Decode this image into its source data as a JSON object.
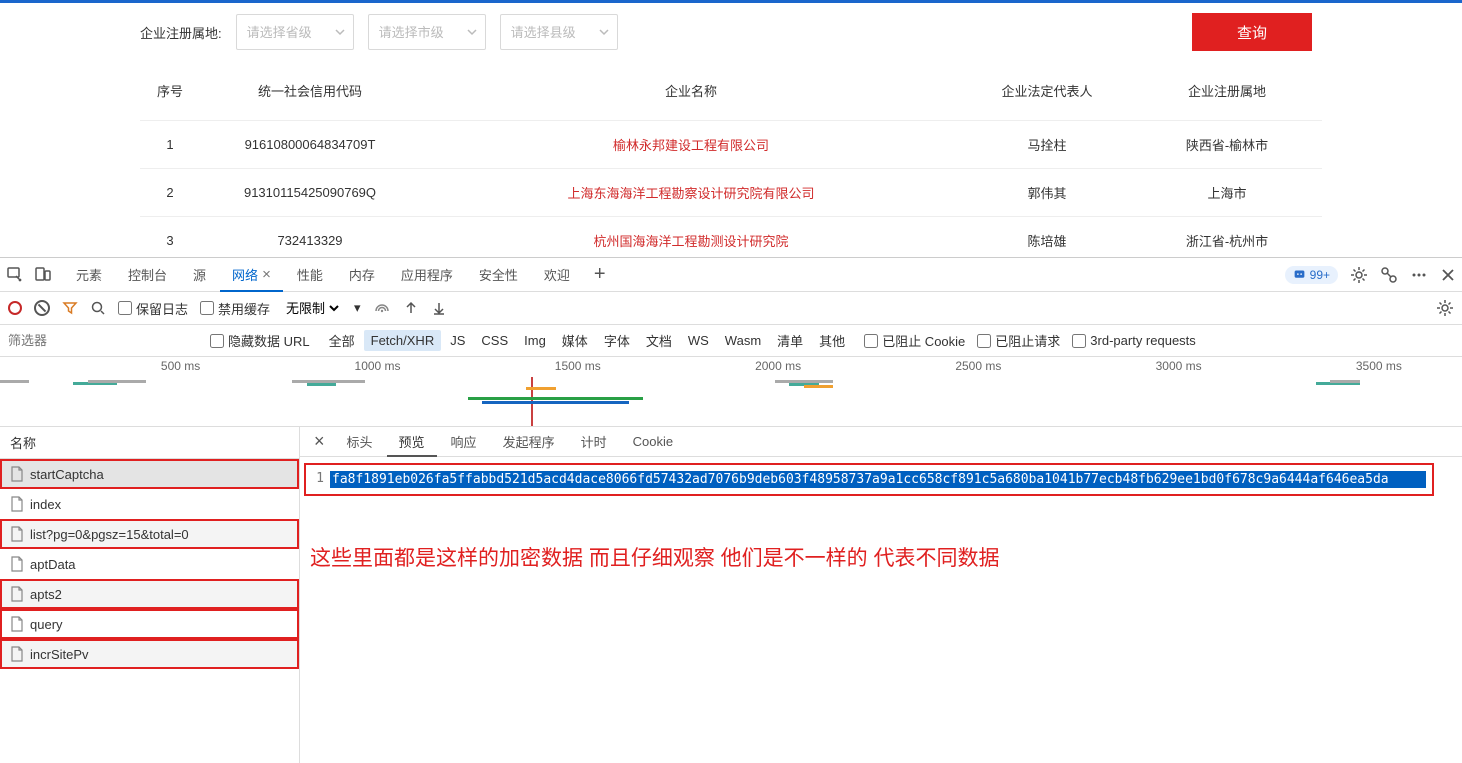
{
  "filter": {
    "label": "企业注册属地:",
    "province_ph": "请选择省级",
    "city_ph": "请选择市级",
    "county_ph": "请选择县级",
    "query_btn": "查询"
  },
  "table": {
    "headers": {
      "idx": "序号",
      "code": "统一社会信用代码",
      "name": "企业名称",
      "rep": "企业法定代表人",
      "loc": "企业注册属地"
    },
    "rows": [
      {
        "idx": "1",
        "code": "91610800064834709T",
        "name": "榆林永邦建设工程有限公司",
        "rep": "马拴柱",
        "loc": "陕西省-榆林市"
      },
      {
        "idx": "2",
        "code": "91310115425090769Q",
        "name": "上海东海海洋工程勘察设计研究院有限公司",
        "rep": "郭伟其",
        "loc": "上海市"
      },
      {
        "idx": "3",
        "code": "732413329",
        "name": "杭州国海海洋工程勘测设计研究院",
        "rep": "陈培雄",
        "loc": "浙江省-杭州市"
      }
    ]
  },
  "devtools": {
    "tabs": [
      "元素",
      "控制台",
      "源",
      "网络",
      "性能",
      "内存",
      "应用程序",
      "安全性",
      "欢迎"
    ],
    "active_tab": "网络",
    "badge": "99+",
    "toolbar": {
      "preserve_log": "保留日志",
      "disable_cache": "禁用缓存",
      "throttle": "无限制"
    },
    "filter": {
      "placeholder": "筛选器",
      "hide_data_url": "隐藏数据 URL",
      "types": [
        "全部",
        "Fetch/XHR",
        "JS",
        "CSS",
        "Img",
        "媒体",
        "字体",
        "文档",
        "WS",
        "Wasm",
        "清单",
        "其他"
      ],
      "active_type": "Fetch/XHR",
      "blocked_cookies": "已阻止 Cookie",
      "blocked_requests": "已阻止请求",
      "third_party": "3rd-party requests"
    },
    "timeline": [
      "500 ms",
      "1000 ms",
      "1500 ms",
      "2000 ms",
      "2500 ms",
      "3000 ms",
      "3500 ms"
    ],
    "requests": {
      "header": "名称",
      "items": [
        {
          "name": "startCaptcha",
          "boxed": true,
          "selected": true
        },
        {
          "name": "index"
        },
        {
          "name": "list?pg=0&pgsz=15&total=0",
          "boxed": true
        },
        {
          "name": "aptData"
        },
        {
          "name": "apts2",
          "boxed": true
        },
        {
          "name": "query",
          "boxed": true
        },
        {
          "name": "incrSitePv",
          "boxed": true
        }
      ]
    },
    "detail": {
      "tabs": [
        "标头",
        "预览",
        "响应",
        "发起程序",
        "计时",
        "Cookie"
      ],
      "active": "预览",
      "line_no": "1",
      "body": "fa8f1891eb026fa5ffabbd521d5acd4dace8066fd57432ad7076b9deb603f48958737a9a1cc658cf891c5a680ba1041b77ecb48fb629ee1bd0f678c9a6444af646ea5da"
    },
    "annotation": "这些里面都是这样的加密数据 而且仔细观察 他们是不一样的 代表不同数据"
  }
}
